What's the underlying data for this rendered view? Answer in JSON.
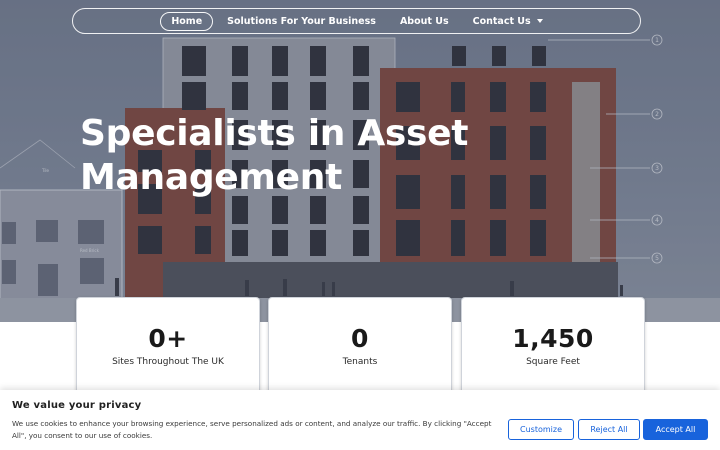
{
  "nav": {
    "items": [
      {
        "label": "Home",
        "active": true
      },
      {
        "label": "Solutions For Your Business",
        "active": false
      },
      {
        "label": "About Us",
        "active": false
      },
      {
        "label": "Contact Us",
        "active": false,
        "dropdown": true
      }
    ]
  },
  "hero": {
    "title_line1": "Specialists in Asset",
    "title_line2": "Management",
    "drawing_labels": [
      "1",
      "2",
      "3",
      "4",
      "5"
    ],
    "drawing_texts": [
      "Tile",
      "Red Brick"
    ]
  },
  "stats": [
    {
      "value": "0+",
      "label": "Sites Throughout The UK"
    },
    {
      "value": "0",
      "label": "Tenants"
    },
    {
      "value": "1,450",
      "label": "Square Feet"
    }
  ],
  "cookie": {
    "title": "We value your privacy",
    "text": "We use cookies to enhance your browsing experience, serve personalized ads or content, and analyze our traffic. By clicking \"Accept All\", you consent to our use of cookies.",
    "customize": "Customize",
    "reject": "Reject All",
    "accept": "Accept All"
  },
  "colors": {
    "accent": "#1863dc",
    "brick": "#8a4a3c",
    "hero_overlay": "#343e56"
  }
}
